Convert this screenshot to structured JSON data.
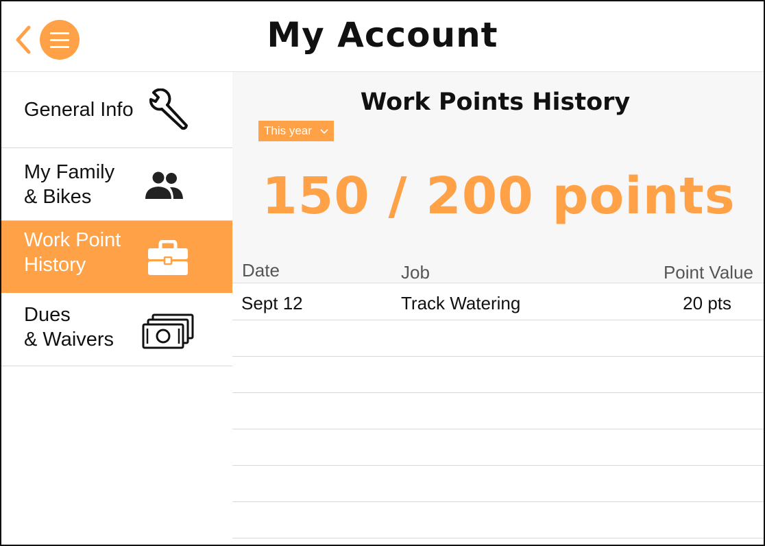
{
  "colors": {
    "accent": "#FFA147",
    "text": "#111111"
  },
  "header": {
    "title": "My Account",
    "back_icon": "chevron-left-icon",
    "menu_icon": "hamburger-menu-icon"
  },
  "sidebar": {
    "items": [
      {
        "label": "General Info",
        "icon": "wrench-icon",
        "active": false
      },
      {
        "label": "My Family\n & Bikes",
        "icon": "people-icon",
        "active": false
      },
      {
        "label": "Work Point\nHistory",
        "icon": "toolbox-icon",
        "active": true
      },
      {
        "label": "Dues\n& Waivers",
        "icon": "cash-stack-icon",
        "active": false
      }
    ]
  },
  "main": {
    "section_title": "Work Points History",
    "filter": {
      "selected": "This year",
      "icon": "chevron-down-icon"
    },
    "points_summary": "150 / 200 points",
    "table": {
      "columns": [
        "Date",
        "Job",
        "Point Value"
      ],
      "rows": [
        [
          "Sept 12",
          "Track Watering",
          "20 pts"
        ],
        [
          "",
          "",
          ""
        ],
        [
          "",
          "",
          ""
        ],
        [
          "",
          "",
          ""
        ],
        [
          "",
          "",
          ""
        ],
        [
          "",
          "",
          ""
        ],
        [
          "",
          "",
          ""
        ]
      ]
    }
  }
}
